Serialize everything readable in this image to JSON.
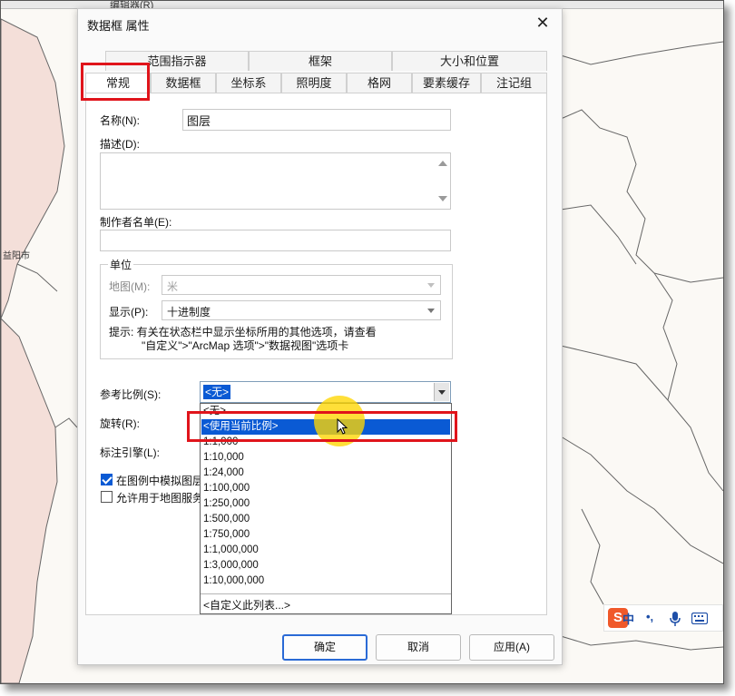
{
  "toolbar": {
    "text": "编辑器(R)"
  },
  "map": {
    "label_city": "益阳市",
    "fill": "#f4dfd9",
    "line": "#666666"
  },
  "dialog": {
    "title": "数据框 属性",
    "close_glyph": "✕",
    "tabs_row1": [
      "范围指示器",
      "框架",
      "大小和位置"
    ],
    "tabs_row2": [
      "常规",
      "数据框",
      "坐标系",
      "照明度",
      "格网",
      "要素缓存",
      "注记组"
    ],
    "active_tab": "常规",
    "name_label": "名称(N):",
    "name_value": "图层",
    "desc_label": "描述(D):",
    "author_label": "制作者名单(E):",
    "units": {
      "title": "单位",
      "map_label": "地图(M):",
      "map_value": "米",
      "display_label": "显示(P):",
      "display_value": "十进制度",
      "hint_line1": "提示: 有关在状态栏中显示坐标所用的其他选项，请查看",
      "hint_line2": "\"自定义\">\"ArcMap 选项\">\"数据视图\"选项卡"
    },
    "ref_scale_label": "参考比例(S):",
    "ref_scale_value": "<无>",
    "rotation_label": "旋转(R):",
    "label_engine_label": "标注引擎(L):",
    "checkbox1_label": "在图例中模拟图层",
    "checkbox2_label": "允许用于地图服务",
    "dropdown": {
      "options": [
        "<无>",
        "<使用当前比例>",
        "1:1,000",
        "1:10,000",
        "1:24,000",
        "1:100,000",
        "1:250,000",
        "1:500,000",
        "1:750,000",
        "1:1,000,000",
        "1:3,000,000",
        "1:10,000,000"
      ],
      "selected": "<使用当前比例>",
      "custom": "<自定义此列表...>"
    },
    "buttons": {
      "ok": "确定",
      "cancel": "取消",
      "apply": "应用(A)"
    }
  },
  "ime": {
    "logo": "S",
    "lang": "中",
    "punct": "•,",
    "mic_icon": "mic-icon",
    "keyboard_icon": "keyboard-icon"
  },
  "colors": {
    "accent": "#0a5ad4",
    "annotation_red": "#e0141b",
    "cursor_highlight": "#ffd600"
  }
}
